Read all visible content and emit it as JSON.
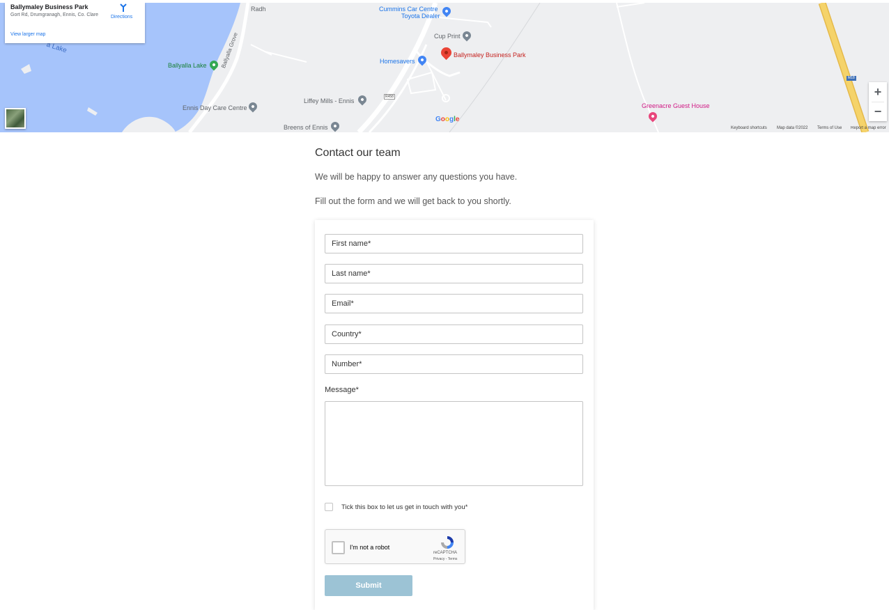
{
  "map": {
    "place_title": "Ballymaley Business Park",
    "place_address": "Gort Rd, Drumgranagh, Ennis, Co. Clare",
    "view_larger": "View larger map",
    "directions": "Directions",
    "labels": {
      "cummins_line1": "Cummins Car Centre",
      "cummins_line2": "Toyota Dealer",
      "cup_print": "Cup Print",
      "ballymaley": "Ballymaley Business Park",
      "homesavers": "Homesavers",
      "ballyalla_lake": "Ballyalla Lake",
      "lake_water": "a Lake",
      "ballyalla_grove": "Ballyalla Grove",
      "liffey_mills": "Liffey Mills - Ennis",
      "ennis_daycare": "Ennis Day Care Centre",
      "breens": "Breens of Ennis",
      "greenacre": "Greenacre Guest House",
      "radh": "Radh",
      "road_r458": "R458",
      "road_m18": "M18"
    },
    "zoom_in": "+",
    "zoom_out": "−",
    "google": "Google",
    "attribution": {
      "shortcuts": "Keyboard shortcuts",
      "map_data": "Map data ©2022",
      "terms": "Terms of Use",
      "report": "Report a map error"
    },
    "colors": {
      "water": "#a6c4fb",
      "land": "#eeeff1",
      "motorway": "#f5d36a",
      "road": "#ffffff"
    }
  },
  "contact": {
    "heading": "Contact our team",
    "line1": "We will be happy to answer any questions you have.",
    "line2": "Fill out the form and we will get back to you shortly."
  },
  "form": {
    "first_name_placeholder": "First name*",
    "last_name_placeholder": "Last name*",
    "email_placeholder": "Email*",
    "country_placeholder": "Country*",
    "number_placeholder": "Number*",
    "message_label": "Message*",
    "consent_label": "Tick this box to let us get in touch with you*",
    "recaptcha_label": "I'm not a robot",
    "recaptcha_brand": "reCAPTCHA",
    "recaptcha_terms": "Privacy - Terms",
    "submit_label": "Submit",
    "submit_color": "#9cc3d5"
  }
}
